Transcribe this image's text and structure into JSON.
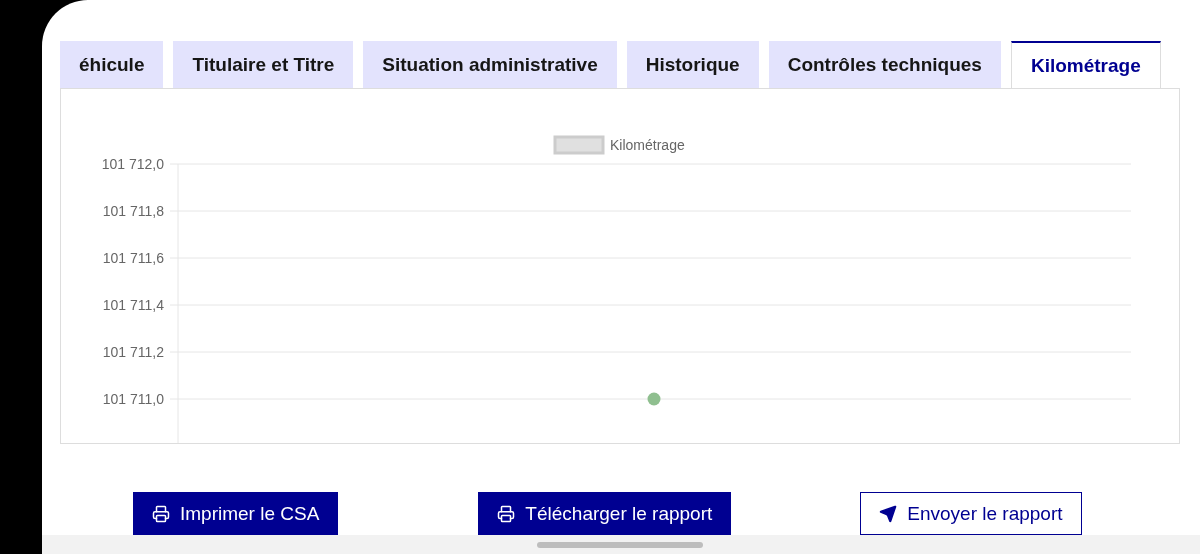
{
  "tabs": [
    {
      "label": "éhicule",
      "selected": false
    },
    {
      "label": "Titulaire et Titre",
      "selected": false
    },
    {
      "label": "Situation administrative",
      "selected": false
    },
    {
      "label": "Historique",
      "selected": false
    },
    {
      "label": "Contrôles techniques",
      "selected": false
    },
    {
      "label": "Kilométrage",
      "selected": true
    }
  ],
  "chart": {
    "chart_data": {
      "type": "scatter",
      "series": [
        {
          "name": "Kilométrage",
          "color": "#8fbf8f",
          "values": [
            101711.0
          ]
        }
      ],
      "ylim": [
        101710.8,
        101712.0
      ],
      "yticks": [
        {
          "value": 101712.0,
          "label": "101 712,0"
        },
        {
          "value": 101711.8,
          "label": "101 711,8"
        },
        {
          "value": 101711.6,
          "label": "101 711,6"
        },
        {
          "value": 101711.4,
          "label": "101 711,4"
        },
        {
          "value": 101711.2,
          "label": "101 711,2"
        },
        {
          "value": 101711.0,
          "label": "101 711,0"
        }
      ],
      "grid": true
    }
  },
  "buttons": [
    {
      "label": "Imprimer le CSA",
      "kind": "print",
      "primary": true
    },
    {
      "label": "Télécharger le rapport",
      "kind": "print",
      "primary": true
    },
    {
      "label": "Envoyer le rapport",
      "kind": "send",
      "primary": false
    }
  ]
}
